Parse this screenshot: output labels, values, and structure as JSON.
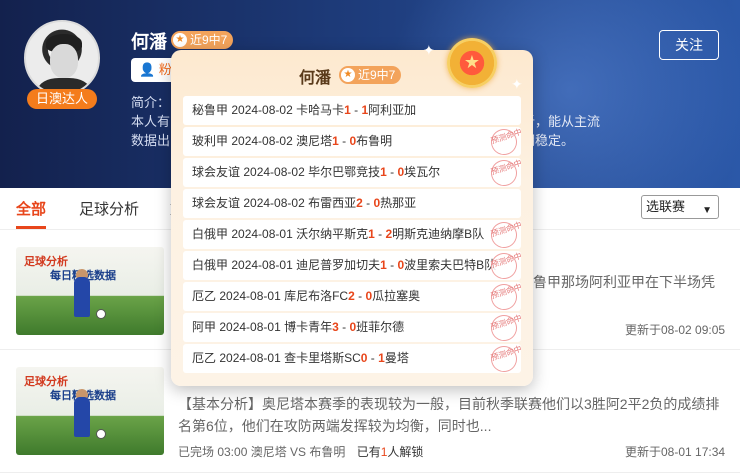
{
  "author": {
    "name": "何潘",
    "badge": "近9中7",
    "expert_tag": "日澳达人",
    "fans_label": "粉丝",
    "intro_label": "简介：",
    "intro_line1": "本人有",
    "intro_line2": "数据出",
    "intro_tail_line1": "析，能从主流",
    "intro_tail_line2": "期稳定。",
    "follow_label": "关注"
  },
  "tabs": [
    {
      "label": "全部",
      "active": true
    },
    {
      "label": "足球分析",
      "active": false
    },
    {
      "label": "篮",
      "active": false
    }
  ],
  "league_select": {
    "value": "选联赛"
  },
  "popup": {
    "title": "何潘",
    "badge": "近9中7",
    "hit_stamp": "预测命中",
    "records": [
      {
        "league": "秘鲁甲",
        "date": "2024-08-02",
        "home": "卡哈马卡",
        "home_score": "1",
        "sep": " - ",
        "away_score": "1",
        "away": "阿利亚加",
        "hit": false
      },
      {
        "league": "玻利甲",
        "date": "2024-08-02",
        "home": "澳尼塔",
        "home_score": "1",
        "sep": " - ",
        "away_score": "0",
        "away": "布鲁明",
        "hit": true
      },
      {
        "league": "球会友谊",
        "date": "2024-08-02",
        "home": "毕尔巴鄂竞技",
        "home_score": "1",
        "sep": " - ",
        "away_score": "0",
        "away": "埃瓦尔",
        "hit": true
      },
      {
        "league": "球会友谊",
        "date": "2024-08-02",
        "home": "布雷西亚",
        "home_score": "2",
        "sep": " - ",
        "away_score": "0",
        "away": "热那亚",
        "hit": false
      },
      {
        "league": "白俄甲",
        "date": "2024-08-01",
        "home": "沃尔纳平斯克",
        "home_score": "1",
        "sep": " - ",
        "away_score": "2",
        "away": "明斯克迪纳摩B队",
        "hit": true
      },
      {
        "league": "白俄甲",
        "date": "2024-08-01",
        "home": "迪尼普罗加切夫",
        "home_score": "1",
        "sep": " - ",
        "away_score": "0",
        "away": "波里索夫巴特B队",
        "hit": true
      },
      {
        "league": "厄乙",
        "date": "2024-08-01",
        "home": "库尼布洛FC",
        "home_score": "2",
        "sep": " - ",
        "away_score": "0",
        "away": "瓜拉塞奥",
        "hit": true
      },
      {
        "league": "阿甲",
        "date": "2024-08-01",
        "home": "博卡青年",
        "home_score": "3",
        "sep": " - ",
        "away_score": "0",
        "away": "班菲尔德",
        "hit": true
      },
      {
        "league": "厄乙",
        "date": "2024-08-01",
        "home": "查卡里塔斯SC",
        "home_score": "0",
        "sep": " - ",
        "away_score": "1",
        "away": "曼塔",
        "hit": true
      }
    ]
  },
  "articles": [
    {
      "thumb_title": "足球分析",
      "thumb_subtitle": "每日精选数据",
      "text_line1": "鲁甲那场阿利亚甲在下半场凭",
      "update": "更新于08-02 09:05"
    },
    {
      "thumb_title": "足球分析",
      "thumb_subtitle": "每日精选数据",
      "text_line1": "【基本分析】奥尼塔本赛季的表现较为一般，目前秋季联赛他们以3胜阿2平2负的成绩排",
      "text_line2": "名第6位，他们在攻防两端发挥较为均衡，同时也...",
      "meta_status": "已完场 03:00 澳尼塔 VS 布鲁明",
      "meta_unlock_prefix": "已有",
      "meta_unlock_count": "1",
      "meta_unlock_suffix": "人解锁",
      "update": "更新于08-01 17:34"
    }
  ],
  "colors": {
    "accent": "#e8461b",
    "banner": "#1d3a78",
    "badge": "#f3a35b"
  },
  "icons": {
    "star": "star-icon",
    "fans": "user-icon",
    "medal": "medal-icon",
    "caret": "chevron-down-icon"
  }
}
